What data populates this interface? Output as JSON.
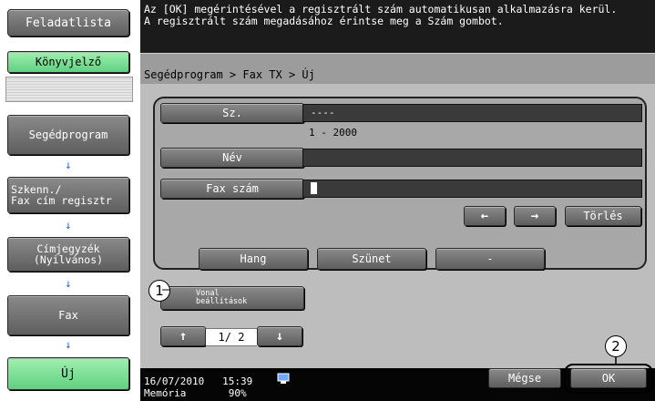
{
  "sidebar": {
    "job_list_label": "Feladatlista",
    "bookmark_label": "Könyvjelző",
    "steps": [
      {
        "label": "Segédprogram"
      },
      {
        "label": "Szkenn./\nFax cím regisztr"
      },
      {
        "label": "Címjegyzék\n(Nyilvános)"
      },
      {
        "label": "Fax"
      },
      {
        "label": "Új"
      }
    ],
    "arrow": "↓"
  },
  "message": {
    "line1": "Az [OK] megérintésével a regisztrált szám automatikusan alkalmazásra kerül.",
    "line2": "A regisztrált szám megadásához érintse meg a Szám gombot."
  },
  "breadcrumb": "Segédprogram > Fax TX > Új",
  "form": {
    "number_label": "Sz.",
    "number_value": "----",
    "number_range": "1 - 2000",
    "name_label": "Név",
    "name_value": "",
    "fax_label": "Fax szám",
    "fax_value": ""
  },
  "controls": {
    "left_arrow": "←",
    "right_arrow": "→",
    "delete_label": "Törlés",
    "tone_label": "Hang",
    "pause_label": "Szünet",
    "dash_label": "-",
    "line_settings_label": "Vonal\nbeállítások",
    "page_indicator": "1/ 2",
    "up_arrow": "↑",
    "down_arrow": "↓"
  },
  "status": {
    "datetime": "16/07/2010   15:39",
    "memory": "Memória       90%",
    "icon": "network-icon"
  },
  "footer": {
    "cancel_label": "Mégse",
    "ok_label": "OK"
  },
  "callouts": [
    "1",
    "2"
  ]
}
